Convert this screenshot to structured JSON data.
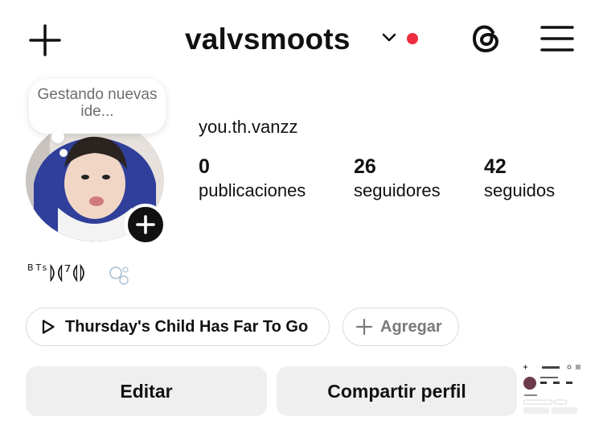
{
  "header": {
    "title": "valvsmoots",
    "icons": {
      "create": "plus-icon",
      "account_switch": "chevron-down-icon",
      "threads": "threads-icon",
      "menu": "hamburger-menu-icon"
    },
    "notification_dot_color": "#ED2E3F"
  },
  "profile": {
    "note": "Gestando nuevas ide...",
    "username": "you.th.vanzz",
    "stats": [
      {
        "value": "0",
        "label": "publicaciones"
      },
      {
        "value": "26",
        "label": "seguidores"
      },
      {
        "value": "42",
        "label": "seguidos"
      }
    ],
    "bio_small": "BTs",
    "bio_large": "⟭⟬⁷⟬⟭"
  },
  "music": {
    "song": "Thursday's Child Has Far To Go",
    "icon": "play-icon"
  },
  "add_link": {
    "label": "Agregar",
    "icon": "plus-icon"
  },
  "actions": {
    "edit": "Editar",
    "share": "Compartir perfil"
  }
}
